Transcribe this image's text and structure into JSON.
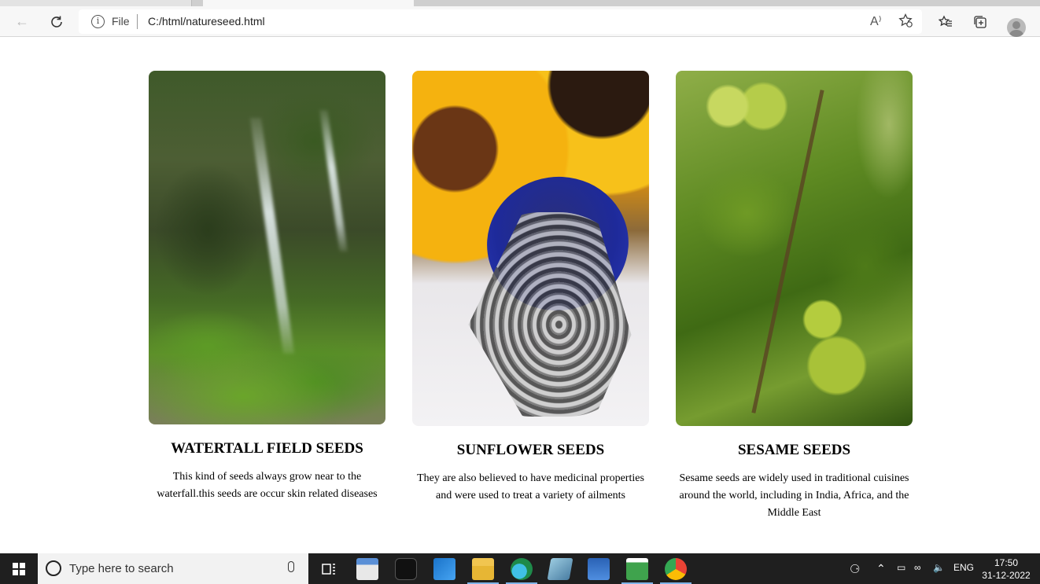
{
  "browser": {
    "address_label": "File",
    "url": "C:/html/natureseed.html",
    "read_aloud_icon": "A⁾"
  },
  "cards": [
    {
      "title": "WATERTALL FIELD SEEDS",
      "description": "This kind of seeds always grow near to the waterfall.this seeds are occur skin related diseases",
      "image": "waterfall-image"
    },
    {
      "title": "SUNFLOWER SEEDS",
      "description": "They are also believed to have medicinal properties and were used to treat a variety of ailments",
      "image": "sunflower-seeds-image"
    },
    {
      "title": "SESAME SEEDS",
      "description": "Sesame seeds are widely used in traditional cuisines around the world, including in India, Africa, and the Middle East",
      "image": "sesame-plant-image"
    }
  ],
  "taskbar": {
    "search_placeholder": "Type here to search",
    "language": "ENG",
    "time": "17:50",
    "date": "31-12-2022"
  }
}
